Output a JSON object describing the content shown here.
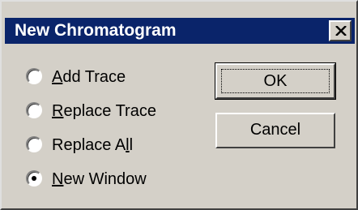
{
  "dialog": {
    "title": "New Chromatogram",
    "close_icon": "close-icon"
  },
  "options": [
    {
      "prefix": "",
      "accel": "A",
      "rest": "dd Trace",
      "selected": false
    },
    {
      "prefix": "",
      "accel": "R",
      "rest": "eplace Trace",
      "selected": false
    },
    {
      "prefix": "Replace A",
      "accel": "l",
      "rest": "l",
      "selected": false
    },
    {
      "prefix": "",
      "accel": "N",
      "rest": "ew Window",
      "selected": true
    }
  ],
  "buttons": {
    "ok_label": "OK",
    "cancel_label": "Cancel"
  }
}
